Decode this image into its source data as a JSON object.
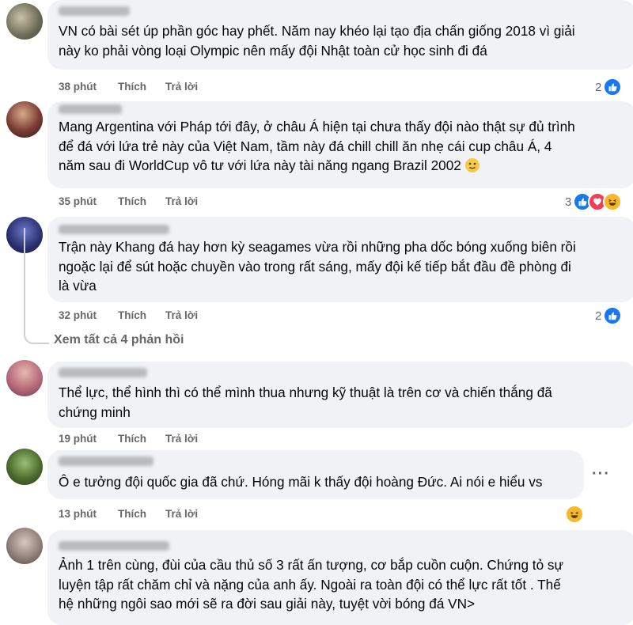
{
  "comments": [
    {
      "text": "VN có bài sét úp phần góc hay phết. Năm nay khéo lại tạo địa chấn giống 2018 vì giải\nnày ko phải vòng loại Olympic nên mấy đội Nhật toàn cử học sinh đi đá",
      "time": "38 phút",
      "like": "Thích",
      "reply": "Trả lời",
      "reaction_count": "2",
      "reactions": [
        "like-icon"
      ]
    },
    {
      "text": "Mang Argentina với Pháp tới đây, ở châu Á hiện tại chưa thấy đội nào thật sự đủ trình\nđể đá với lứa trẻ này của Việt Nam, tầm này đá chill chill ăn nhẹ cái cup châu Á, 4\nnăm sau đi WorldCup vô tư với lứa này tài năng ngang Brazil 2002",
      "time": "35 phút",
      "like": "Thích",
      "reply": "Trả lời",
      "reaction_count": "3",
      "reactions": [
        "like-icon",
        "love-icon",
        "haha-icon"
      ]
    },
    {
      "text": "Trận này Khang đá hay hơn kỳ seagames vừa rồi những pha dốc bóng xuống biên rồi\nngoặc lại để sút hoặc chuyền vào trong rất sáng, mấy đội kế tiếp bắt đầu đề phòng đi\nlà vừa",
      "time": "32 phút",
      "like": "Thích",
      "reply": "Trả lời",
      "reaction_count": "2",
      "reactions": [
        "like-icon"
      ]
    },
    {
      "text": "Thể lực, thể hình thì có thể mình thua nhưng kỹ thuật là trên cơ và chiến thắng đã\nchứng minh",
      "time": "19 phút",
      "like": "Thích",
      "reply": "Trả lời",
      "reaction_count": "",
      "reactions": []
    },
    {
      "text": "Ô e tưởng đội quốc gia đã chứ. Hóng mãi k thấy đội hoàng Đức. Ai nói e hiểu vs",
      "time": "13 phút",
      "like": "Thích",
      "reply": "Trả lời",
      "reaction_count": "",
      "reactions": [
        "haha-icon"
      ]
    },
    {
      "text": "Ảnh 1 trên cùng, đùi của cầu thủ số 3 rất ấn tượng, cơ bắp cuồn cuộn. Chứng tỏ sự\nluyện tập rất chăm chỉ và nặng của anh ấy. Ngoài ra toàn đội có thể lực rất tốt . Thế\nhệ những ngôi sao mới sẽ ra đời sau giải này, tuyệt vời bóng đá VN>",
      "time": "",
      "like": "",
      "reply": "",
      "reaction_count": "",
      "reactions": []
    }
  ],
  "view_replies": "Xem tất cả 4 phản hồi",
  "more_options": "···",
  "colors": {
    "bubble": "#f0f2f5",
    "meta_text": "#65676b",
    "like": "#1877f2",
    "love": "#f33e58",
    "haha": "#f7b928"
  }
}
